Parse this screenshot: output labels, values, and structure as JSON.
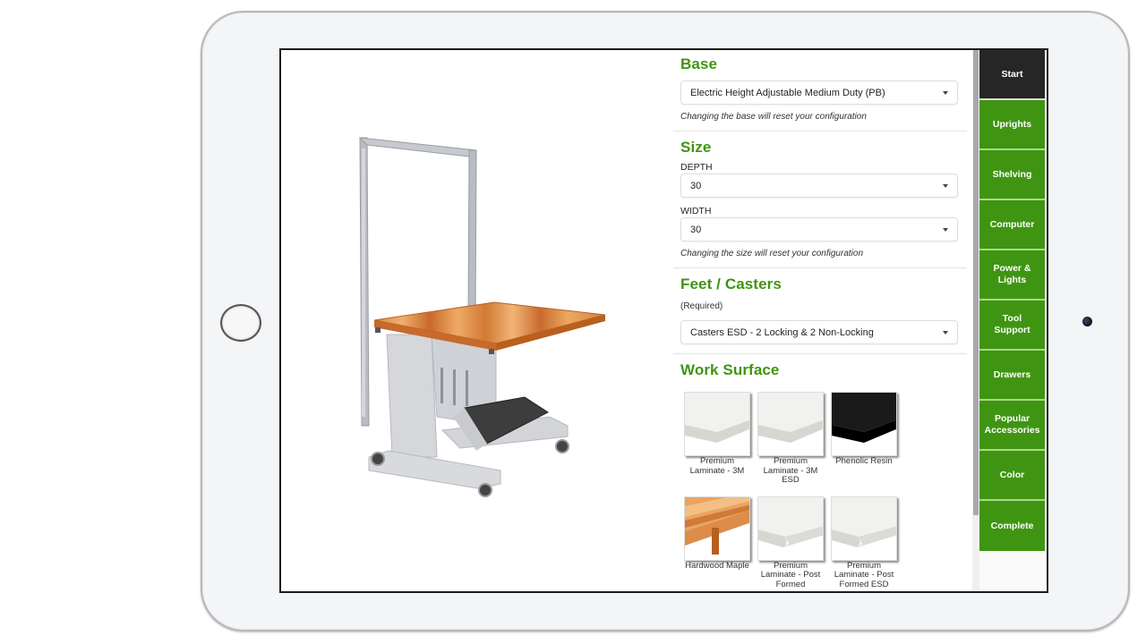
{
  "device": {
    "type": "tablet",
    "home_button": "home-button",
    "camera": "front-camera"
  },
  "viewer": {
    "alt": "3D preview of electric height adjustable workbench with hardwood maple top, upright frame, footrest and casters"
  },
  "panel": {
    "base": {
      "title": "Base",
      "selected": "Electric Height Adjustable Medium Duty (PB)",
      "note": "Changing the base will reset your configuration"
    },
    "size": {
      "title": "Size",
      "depth_label": "DEPTH",
      "depth_value": "30",
      "width_label": "WIDTH",
      "width_value": "30",
      "note": "Changing the size will reset your configuration"
    },
    "feet": {
      "title": "Feet / Casters",
      "required": "(Required)",
      "selected": "Casters ESD - 2 Locking & 2 Non-Locking"
    },
    "work_surface": {
      "title": "Work Surface",
      "options": [
        {
          "label": "Premium Laminate - 3M",
          "swatch": "light-gray"
        },
        {
          "label": "Premium Laminate - 3M ESD",
          "swatch": "light-gray"
        },
        {
          "label": "Phenolic Resin",
          "swatch": "black"
        },
        {
          "label": "Hardwood Maple",
          "swatch": "maple"
        },
        {
          "label": "Premium Laminate - Post Formed",
          "swatch": "light-gray-rounded"
        },
        {
          "label": "Premium Laminate - Post Formed ESD",
          "swatch": "light-gray-rounded"
        }
      ]
    }
  },
  "nav": {
    "items": [
      {
        "label": "Start",
        "active": true
      },
      {
        "label": "Uprights"
      },
      {
        "label": "Shelving"
      },
      {
        "label": "Computer"
      },
      {
        "label": "Power & Lights"
      },
      {
        "label": "Tool Support"
      },
      {
        "label": "Drawers"
      },
      {
        "label": "Popular Accessories"
      },
      {
        "label": "Color"
      },
      {
        "label": "Complete"
      }
    ]
  },
  "colors": {
    "accent_green": "#3f9511",
    "nav_active": "#262626",
    "nav_separator": "#a9d98a"
  }
}
